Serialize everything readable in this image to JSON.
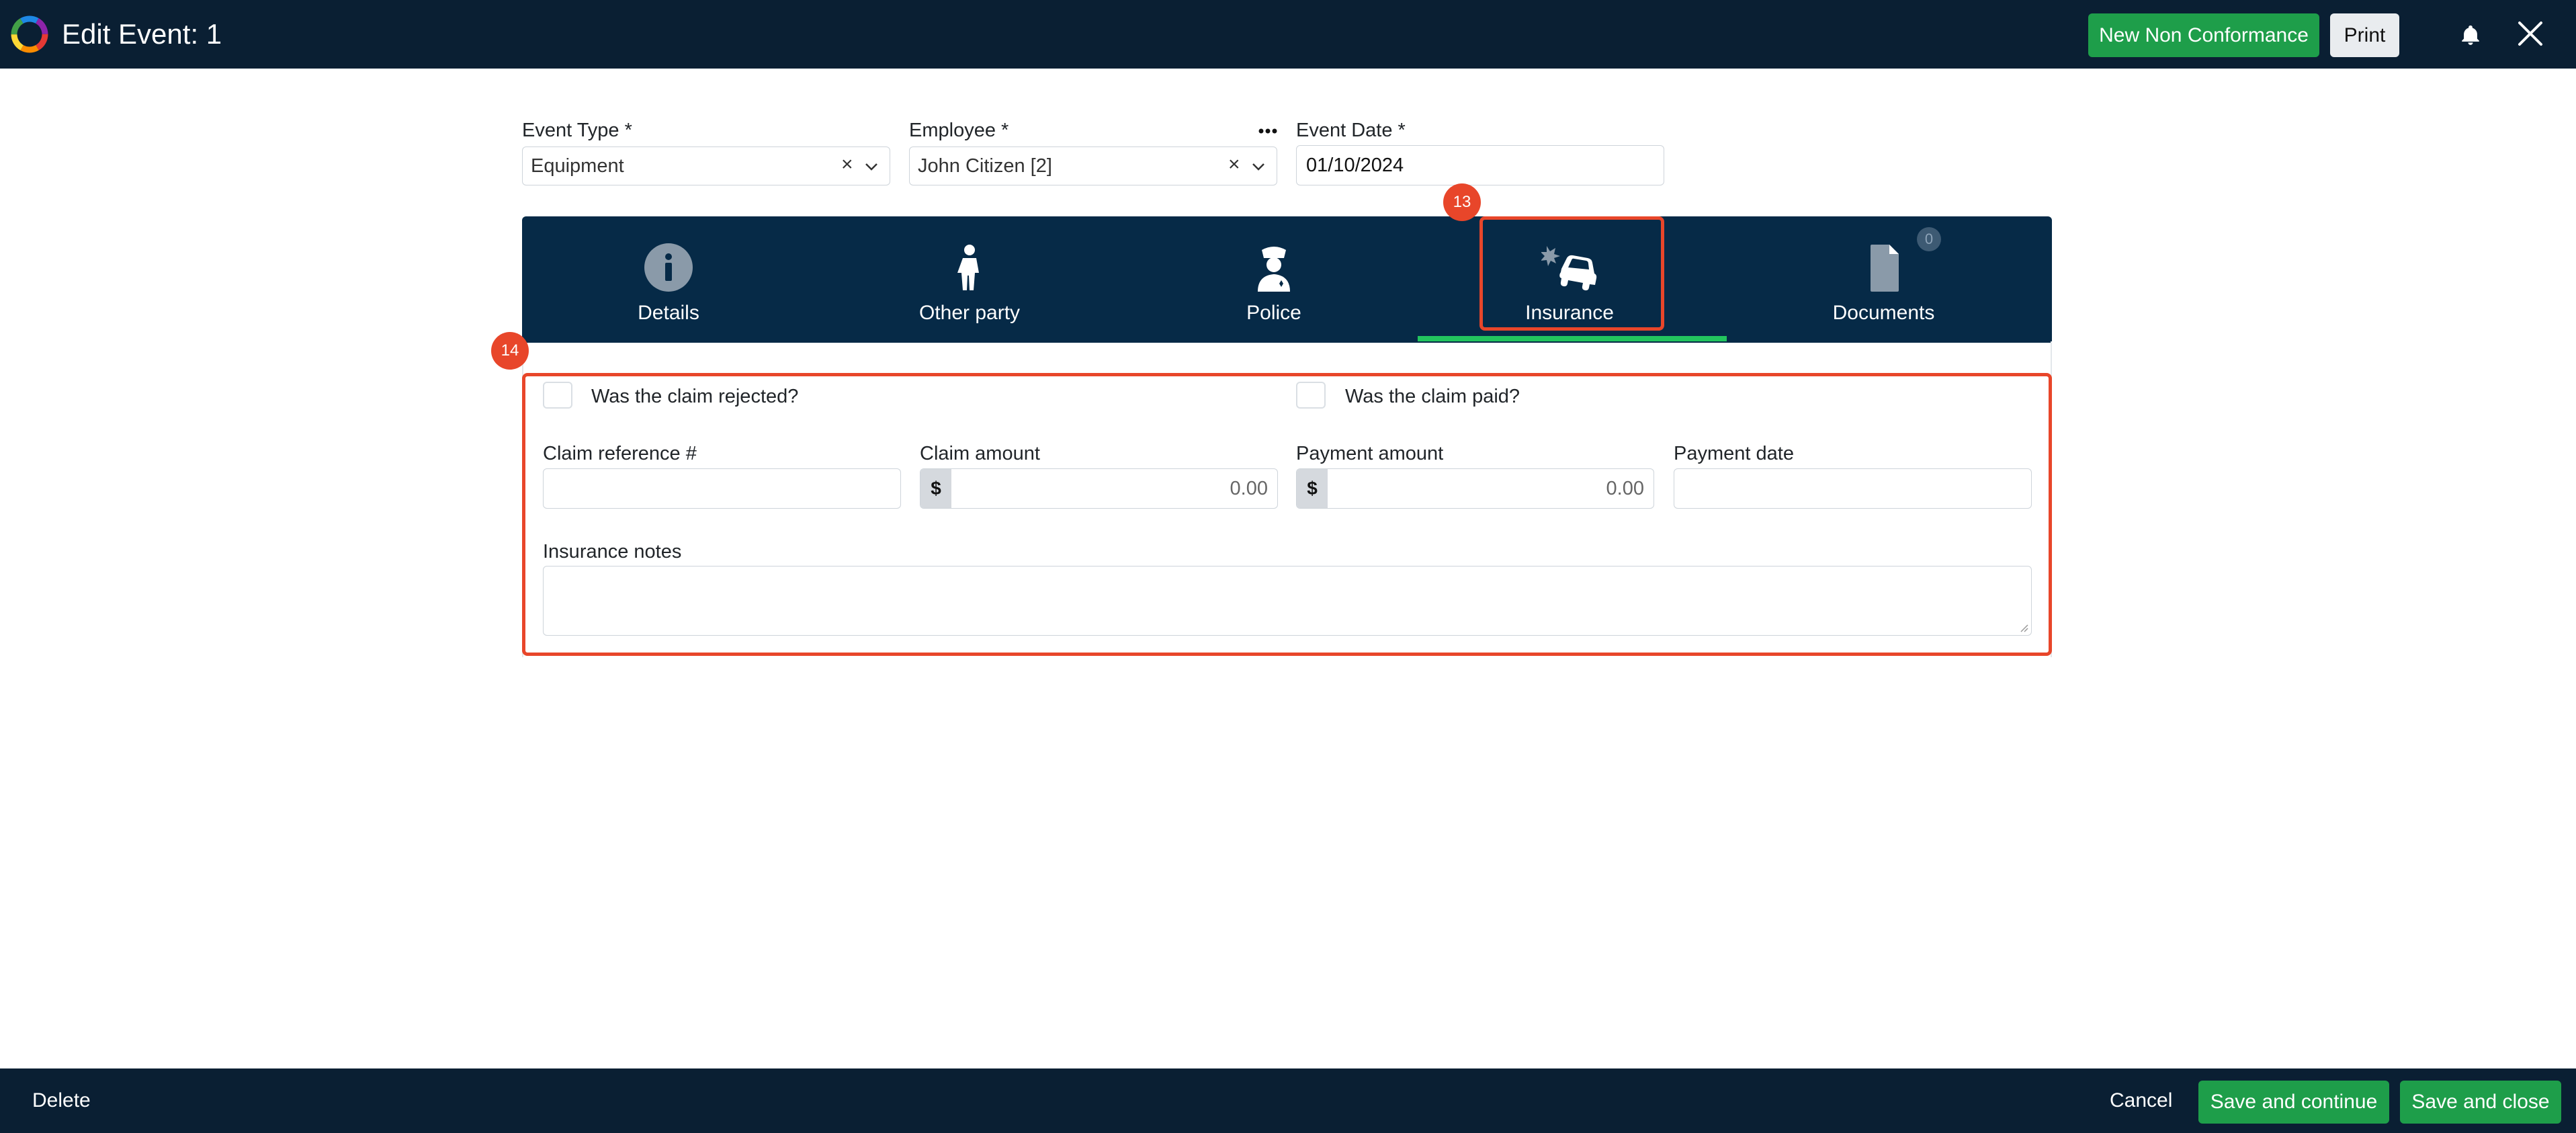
{
  "header": {
    "title": "Edit Event: 1",
    "new_nc_label": "New Non Conformance",
    "print_label": "Print",
    "brand_colors": [
      "#e53935",
      "#fb8c00",
      "#fdd835",
      "#43a047",
      "#1e88e5",
      "#8e24aa"
    ]
  },
  "fields": {
    "event_type": {
      "label": "Event Type *",
      "value": "Equipment"
    },
    "employee": {
      "label": "Employee *",
      "value": "John Citizen [2]"
    },
    "event_date": {
      "label": "Event Date *",
      "value": "01/10/2024"
    },
    "clear_glyph": "×"
  },
  "tabs": [
    {
      "label": "Details",
      "icon": "info-circle-icon"
    },
    {
      "label": "Other party",
      "icon": "person-icon"
    },
    {
      "label": "Police",
      "icon": "police-officer-icon"
    },
    {
      "label": "Insurance",
      "icon": "car-crash-icon",
      "active": true
    },
    {
      "label": "Documents",
      "icon": "document-icon",
      "count": "0"
    }
  ],
  "insurance": {
    "claim_rejected_label": "Was the claim rejected?",
    "claim_paid_label": "Was the claim paid?",
    "claim_reference_label": "Claim reference #",
    "claim_amount_label": "Claim amount",
    "claim_amount_value": "0.00",
    "payment_amount_label": "Payment amount",
    "payment_amount_value": "0.00",
    "payment_date_label": "Payment date",
    "notes_label": "Insurance notes",
    "currency_symbol": "$"
  },
  "annotations": {
    "tab_marker": "13",
    "form_marker": "14",
    "color": "#e8462a"
  },
  "footer": {
    "delete_label": "Delete",
    "cancel_label": "Cancel",
    "save_continue_label": "Save and continue",
    "save_close_label": "Save and close"
  },
  "colors": {
    "nav_bg": "#0a1f33",
    "tab_bg": "#062a47",
    "accent_green": "#1e9e4a",
    "active_tab_line": "#22c55e"
  }
}
